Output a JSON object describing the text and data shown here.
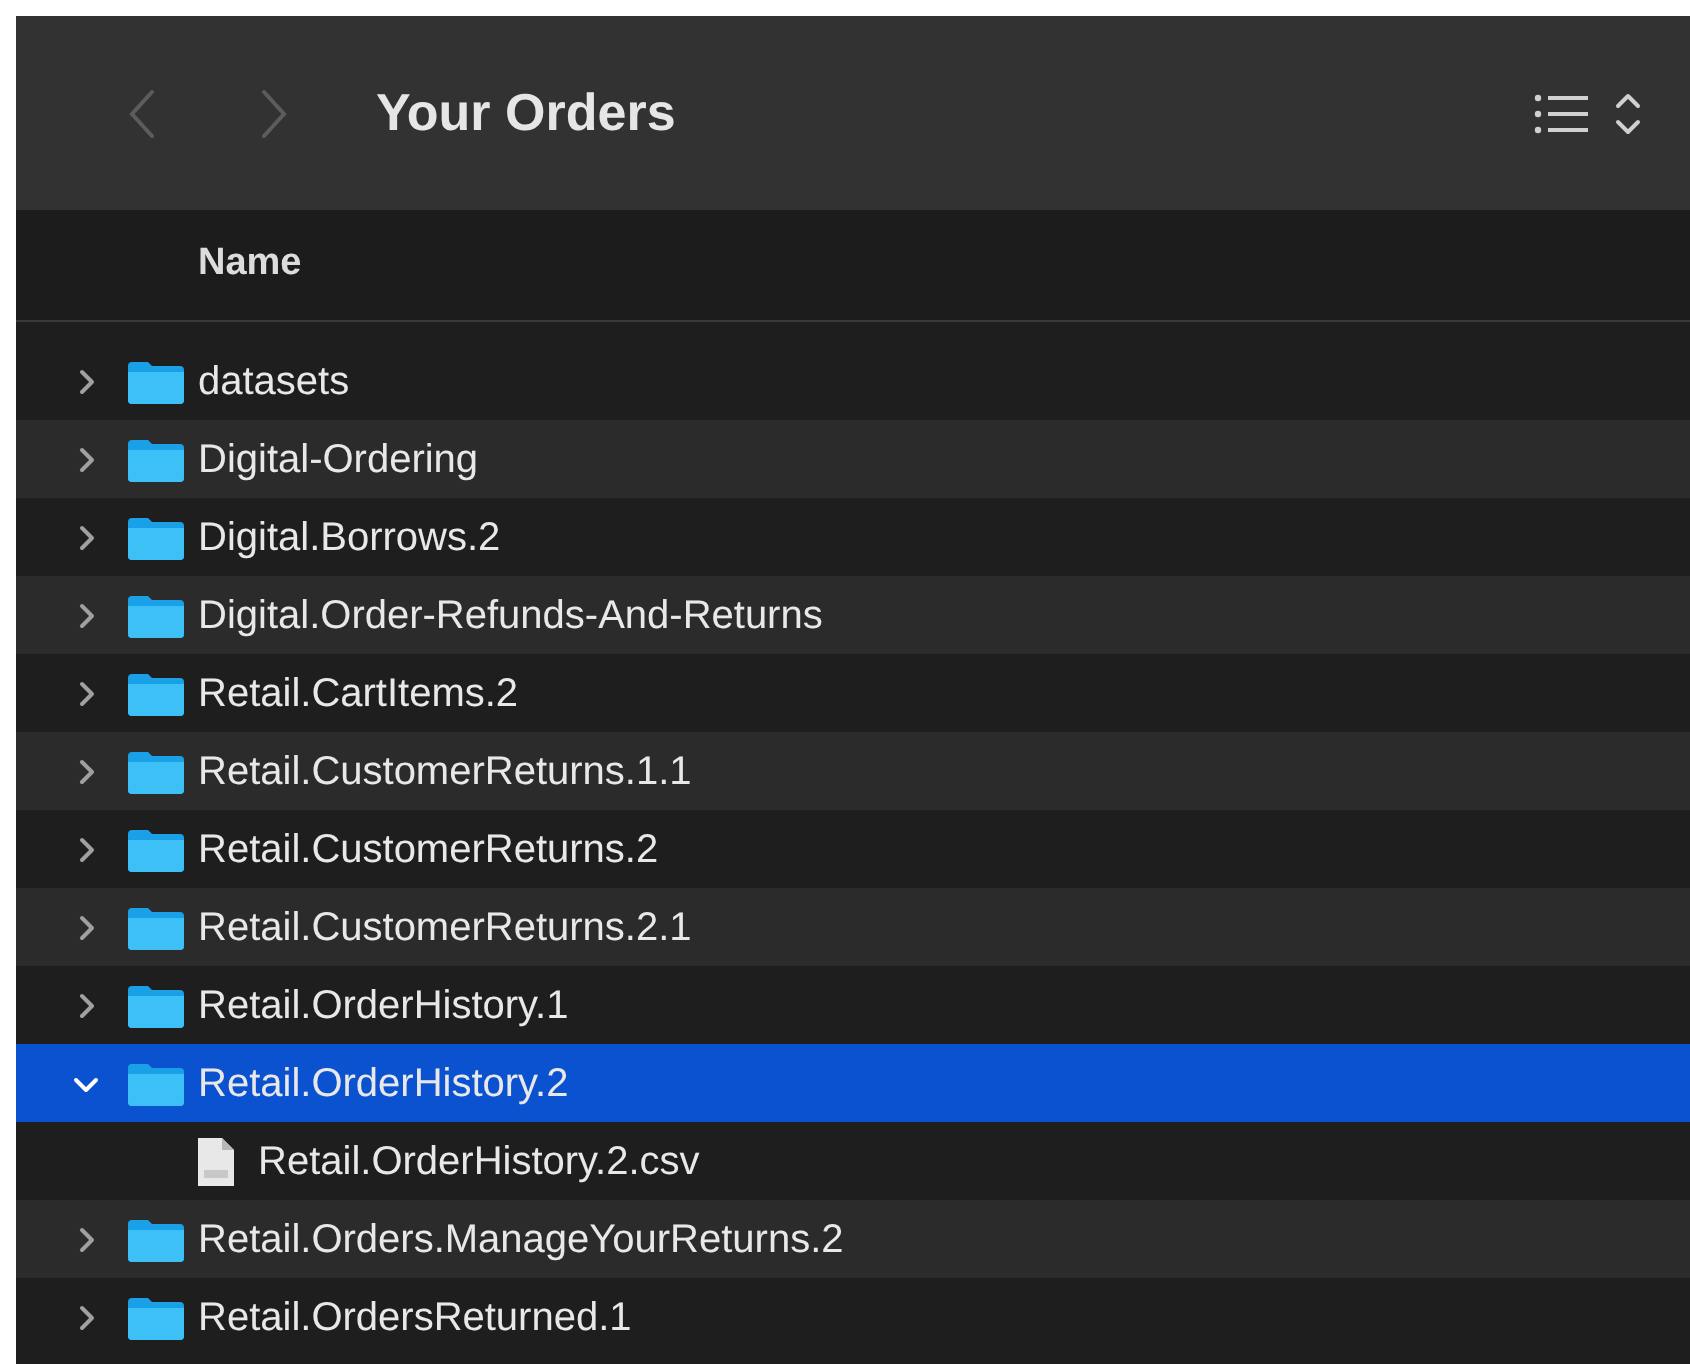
{
  "window": {
    "title": "Your Orders"
  },
  "toolbar": {
    "back_enabled": false,
    "forward_enabled": false
  },
  "columns": [
    {
      "label": "Name"
    }
  ],
  "items": [
    {
      "name": "datasets",
      "kind": "folder",
      "expanded": false,
      "selected": false
    },
    {
      "name": "Digital-Ordering",
      "kind": "folder",
      "expanded": false,
      "selected": false
    },
    {
      "name": "Digital.Borrows.2",
      "kind": "folder",
      "expanded": false,
      "selected": false
    },
    {
      "name": "Digital.Order-Refunds-And-Returns",
      "kind": "folder",
      "expanded": false,
      "selected": false
    },
    {
      "name": "Retail.CartItems.2",
      "kind": "folder",
      "expanded": false,
      "selected": false
    },
    {
      "name": "Retail.CustomerReturns.1.1",
      "kind": "folder",
      "expanded": false,
      "selected": false
    },
    {
      "name": "Retail.CustomerReturns.2",
      "kind": "folder",
      "expanded": false,
      "selected": false
    },
    {
      "name": "Retail.CustomerReturns.2.1",
      "kind": "folder",
      "expanded": false,
      "selected": false
    },
    {
      "name": "Retail.OrderHistory.1",
      "kind": "folder",
      "expanded": false,
      "selected": false
    },
    {
      "name": "Retail.OrderHistory.2",
      "kind": "folder",
      "expanded": true,
      "selected": true,
      "children": [
        {
          "name": "Retail.OrderHistory.2.csv",
          "kind": "file",
          "selected": false
        }
      ]
    },
    {
      "name": "Retail.Orders.ManageYourReturns.2",
      "kind": "folder",
      "expanded": false,
      "selected": false
    },
    {
      "name": "Retail.OrdersReturned.1",
      "kind": "folder",
      "expanded": false,
      "selected": false
    }
  ]
}
